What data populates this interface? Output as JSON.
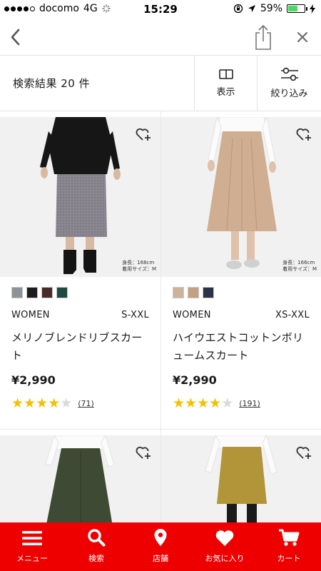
{
  "status_bar": {
    "carrier": "docomo",
    "network": "4G",
    "time": "15:29",
    "battery": "59%",
    "battery_level": 0.59
  },
  "toolbar": {
    "result_count": "検索結果 20 件",
    "display_label": "表示",
    "filter_label": "絞り込み"
  },
  "products": [
    {
      "gender": "WOMEN",
      "sizes": "S-XXL",
      "name": "メリノブレンドリブスカート",
      "price": "¥2,990",
      "rating": 4,
      "reviews": "(71)",
      "swatches": [
        "#8c9298",
        "#1c1c1c",
        "#4a2a26",
        "#1f4a42"
      ],
      "model_height": "身長：168cm",
      "model_size": "着用サイズ：M"
    },
    {
      "gender": "WOMEN",
      "sizes": "XS-XXL",
      "name": "ハイウエストコットンボリュームスカート",
      "price": "¥2,990",
      "rating": 4,
      "reviews": "(191)",
      "swatches": [
        "#cdb39c",
        "#c49f82",
        "#2b3246"
      ],
      "model_height": "身長：166cm",
      "model_size": "着用サイズ：M"
    }
  ],
  "tab_bar": {
    "color": "#ee0000",
    "items": [
      {
        "label": "メニュー",
        "icon": "menu-icon"
      },
      {
        "label": "検索",
        "icon": "search-icon"
      },
      {
        "label": "店舗",
        "icon": "map-pin-icon"
      },
      {
        "label": "お気に入り",
        "icon": "heart-icon"
      },
      {
        "label": "カート",
        "icon": "cart-icon"
      }
    ]
  }
}
